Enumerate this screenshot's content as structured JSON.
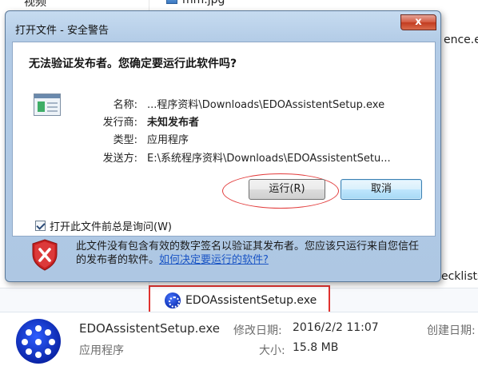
{
  "explorer": {
    "rows": [
      "视频",
      "mm.jpg",
      "ence.ex",
      "ecklists"
    ],
    "selected_file": "EDOAssistentSetup.exe",
    "details": {
      "name": "EDOAssistentSetup.exe",
      "type": "应用程序",
      "modified_label": "修改日期:",
      "modified_value": "2016/2/2 11:07",
      "created_label": "创建日期:",
      "size_label": "大小:",
      "size_value": "15.8 MB"
    }
  },
  "dialog": {
    "title": "打开文件 - 安全警告",
    "close_symbol": "x",
    "question": "无法验证发布者。您确定要运行此软件吗?",
    "fields": {
      "name_label": "名称:",
      "name_value": "...程序资料\\Downloads\\EDOAssistentSetup.exe",
      "publisher_label": "发行商:",
      "publisher_value": "未知发布者",
      "type_label": "类型:",
      "type_value": "应用程序",
      "from_label": "发送方:",
      "from_value": "E:\\系统程序资料\\Downloads\\EDOAssistentSetu..."
    },
    "run_label": "运行(R)",
    "cancel_label": "取消",
    "checkbox_label": "打开此文件前总是询问(W)",
    "checkbox_checked": true,
    "warning_text": "此文件没有包含有效的数字签名以验证其发布者。您应该只运行来自您信任的发布者的软件。",
    "warning_link": "如何决定要运行的软件?"
  },
  "colors": {
    "annotation_red": "#e23a3a",
    "link_blue": "#1a55c5",
    "shield_red": "#c62020"
  },
  "icons": [
    "close-icon",
    "file-program-icon",
    "shield-warning-icon",
    "checkbox-check-icon",
    "edo-app-icon"
  ]
}
